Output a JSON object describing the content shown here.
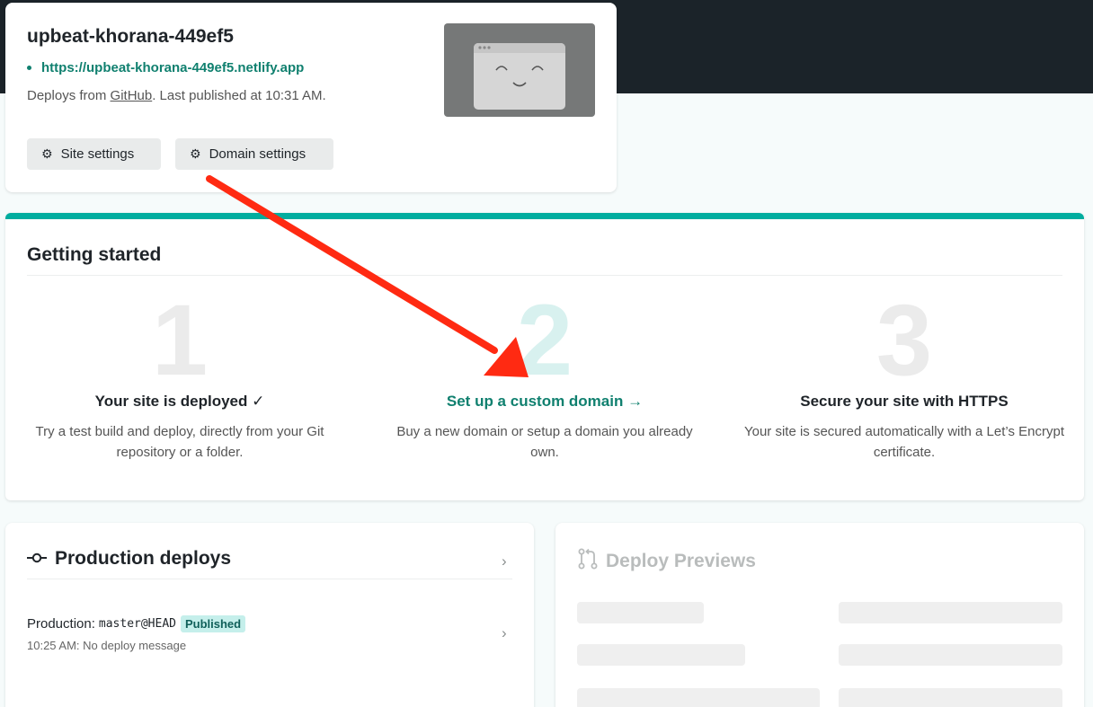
{
  "site": {
    "name": "upbeat-khorana-449ef5",
    "url": "https://upbeat-khorana-449ef5.netlify.app",
    "deploy_prefix": "Deploys from ",
    "deploy_source": "GitHub",
    "deploy_suffix": ". Last published at 10:31 AM.",
    "buttons": {
      "site_settings": "Site settings",
      "domain_settings": "Domain settings"
    },
    "thumbnail_icon": "smiley-browser-icon"
  },
  "getting_started": {
    "title": "Getting started",
    "steps": [
      {
        "number": "1",
        "heading": "Your site is deployed ✓",
        "description": "Try a test build and deploy, directly from your Git repository or a folder."
      },
      {
        "number": "2",
        "heading": "Set up a custom domain →",
        "description": "Buy a new domain or setup a domain you already own."
      },
      {
        "number": "3",
        "heading": "Secure your site with HTTPS",
        "description": "Your site is secured automatically with a Let’s Encrypt certificate."
      }
    ]
  },
  "production": {
    "title": "Production deploys",
    "row_label": "Production:",
    "row_branch": "master@HEAD",
    "row_badge": "Published",
    "row_sub": "10:25 AM: No deploy message"
  },
  "previews": {
    "title": "Deploy Previews"
  },
  "colors": {
    "accent": "#00ad9f",
    "link": "#10806f",
    "topbar": "#1b2329",
    "annotation_arrow": "#ff2a12"
  }
}
